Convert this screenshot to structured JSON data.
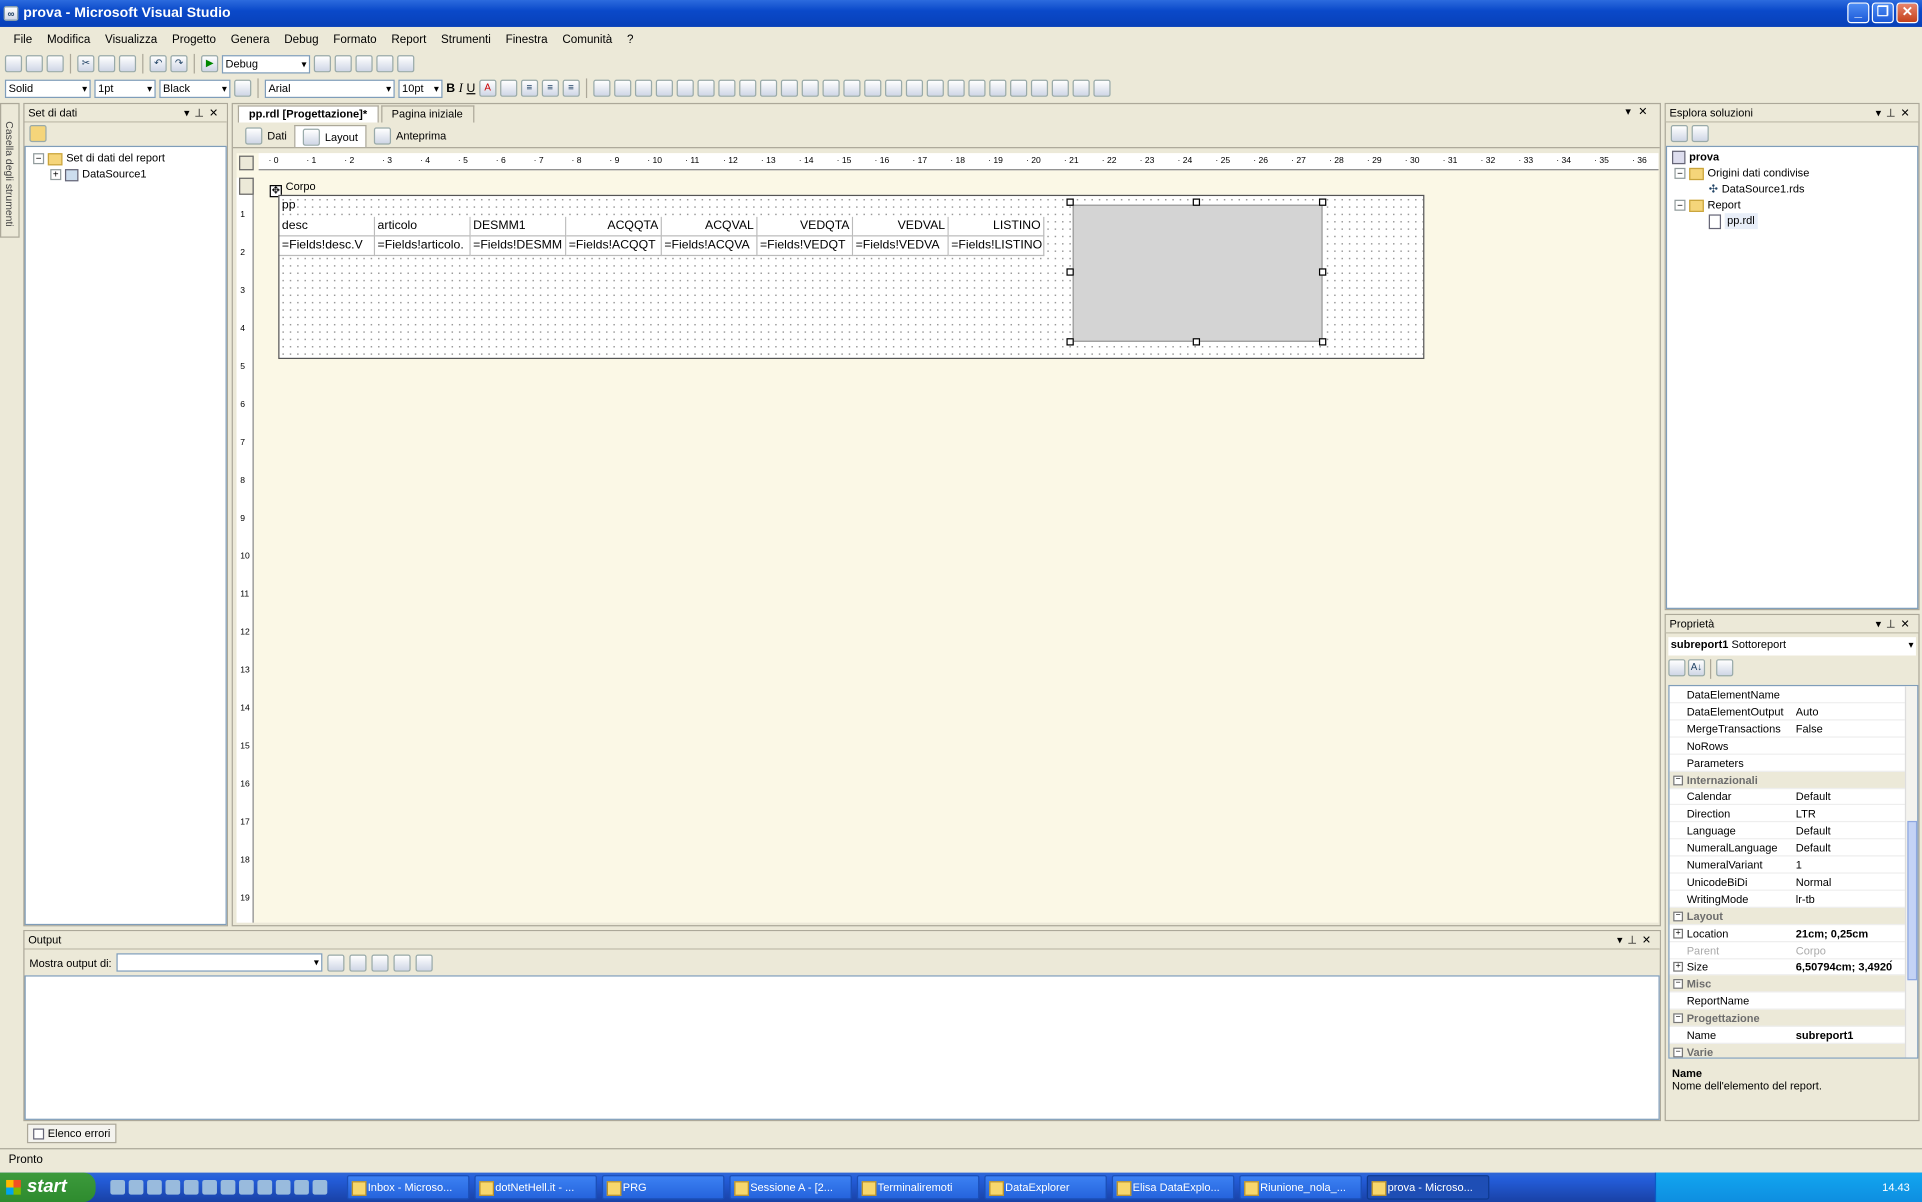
{
  "window": {
    "title": "prova - Microsoft Visual Studio"
  },
  "menu": [
    "File",
    "Modifica",
    "Visualizza",
    "Progetto",
    "Genera",
    "Debug",
    "Formato",
    "Report",
    "Strumenti",
    "Finestra",
    "Comunità",
    "?"
  ],
  "toolbar": {
    "config": "Debug",
    "line_style": "Solid",
    "line_width": "1pt",
    "line_color": "Black",
    "font": "Arial",
    "font_size": "10pt",
    "bold": "B",
    "italic": "I",
    "underline": "U"
  },
  "left_panel": {
    "title": "Set di dati",
    "toolbox_tab": "Casella degli strumenti",
    "tree": {
      "root": "Set di dati del report",
      "child": "DataSource1"
    }
  },
  "doc": {
    "tabs": [
      "pp.rdl [Progettazione]*",
      "Pagina iniziale"
    ],
    "subtabs": [
      "Dati",
      "Layout",
      "Anteprima"
    ],
    "section": "Corpo",
    "title_textbox": "pp"
  },
  "table": {
    "headers": [
      "desc",
      "articolo",
      "DESMM1",
      "ACQQTA",
      "ACQVAL",
      "VEDQTA",
      "VEDVAL",
      "LISTINO"
    ],
    "details": [
      "=Fields!desc.V",
      "=Fields!articolo.",
      "=Fields!DESMM",
      "=Fields!ACQQT",
      "=Fields!ACQVA",
      "=Fields!VEDQT",
      "=Fields!VEDVA",
      "=Fields!LISTINO"
    ]
  },
  "solution": {
    "title": "Esplora soluzioni",
    "project": "prova",
    "shared": "Origini dati condivise",
    "ds": "DataSource1.rds",
    "reports": "Report",
    "rdl": "pp.rdl"
  },
  "properties": {
    "title": "Proprietà",
    "object": "subreport1",
    "object_type": "Sottoreport",
    "rows": [
      {
        "k": "DataElementName",
        "v": ""
      },
      {
        "k": "DataElementOutput",
        "v": "Auto"
      },
      {
        "k": "MergeTransactions",
        "v": "False"
      },
      {
        "k": "NoRows",
        "v": ""
      },
      {
        "k": "Parameters",
        "v": ""
      },
      {
        "cat": "Internazionali"
      },
      {
        "k": "Calendar",
        "v": "Default"
      },
      {
        "k": "Direction",
        "v": "LTR"
      },
      {
        "k": "Language",
        "v": "Default"
      },
      {
        "k": "NumeralLanguage",
        "v": "Default"
      },
      {
        "k": "NumeralVariant",
        "v": "1"
      },
      {
        "k": "UnicodeBiDi",
        "v": "Normal"
      },
      {
        "k": "WritingMode",
        "v": "lr-tb"
      },
      {
        "cat": "Layout"
      },
      {
        "k": "Location",
        "v": "21cm; 0,25cm",
        "b": true,
        "pm": true
      },
      {
        "k": "Parent",
        "v": "Corpo",
        "dim": true
      },
      {
        "k": "Size",
        "v": "6,50794cm; 3,4920́",
        "b": true,
        "pm": true
      },
      {
        "cat": "Misc"
      },
      {
        "k": "ReportName",
        "v": ""
      },
      {
        "cat": "Progettazione"
      },
      {
        "k": "Name",
        "v": "subreport1",
        "b": true
      },
      {
        "cat": "Varie"
      }
    ],
    "desc_title": "Name",
    "desc_text": "Nome dell'elemento del report."
  },
  "output": {
    "title": "Output",
    "show_label": "Mostra output di:",
    "errors_tab": "Elenco errori"
  },
  "status": "Pronto",
  "taskbar": {
    "start": "start",
    "items": [
      "Inbox - Microso...",
      "dotNetHell.it - ...",
      "PRG",
      "Sessione A - [2...",
      "Terminaliremoti",
      "DataExplorer",
      "Elisa DataExplo...",
      "Riunione_nola_...",
      "prova - Microso..."
    ],
    "clock": "14.43"
  }
}
